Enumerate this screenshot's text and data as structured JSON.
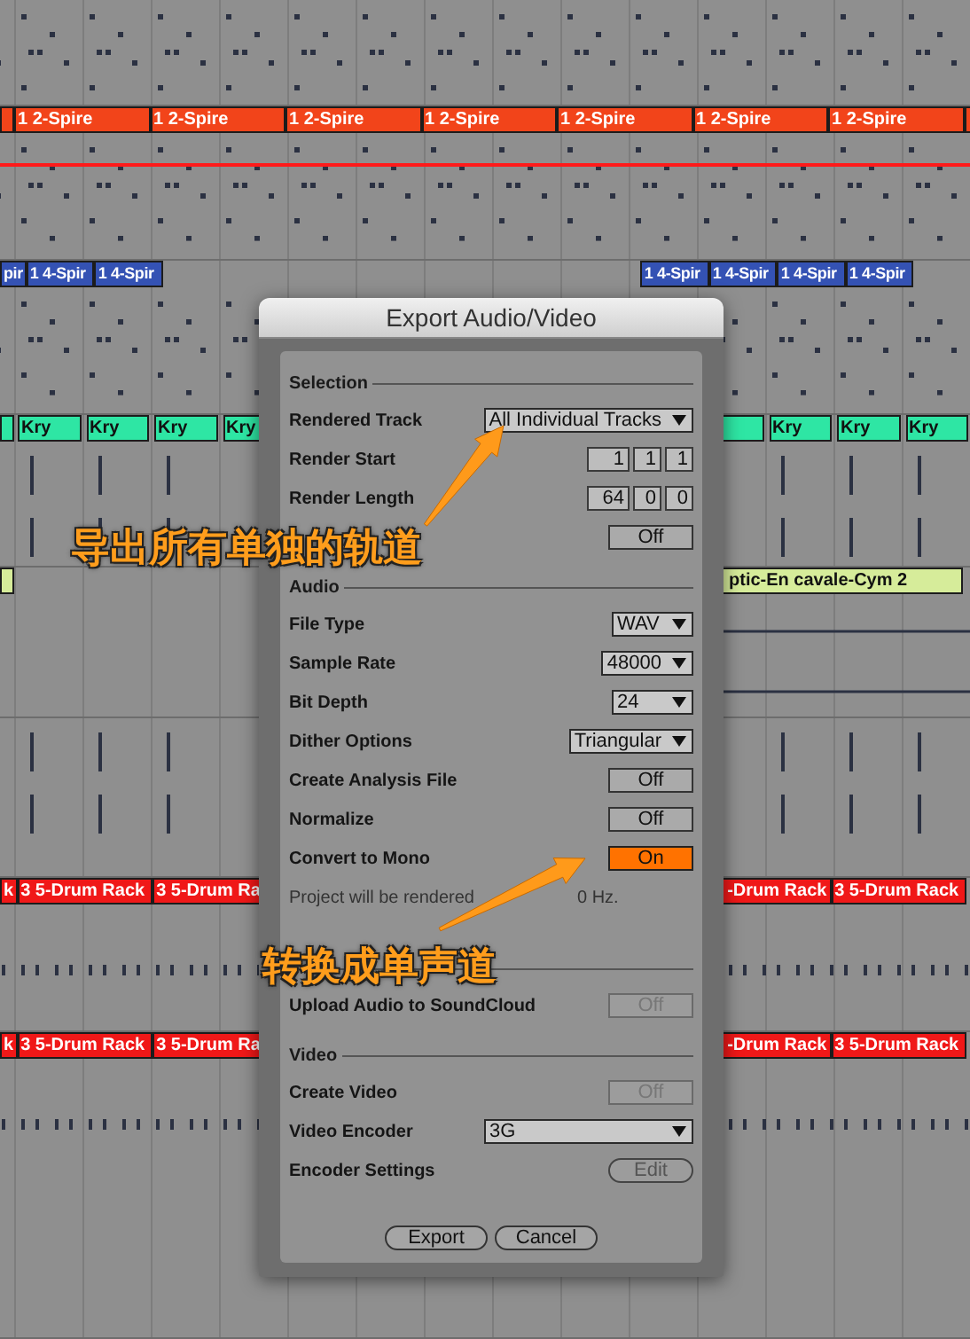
{
  "arrangement": {
    "tracks": [
      {
        "kind": "notes"
      },
      {
        "kind": "lead",
        "color": "#f2441a",
        "clips": [
          {
            "kind": "edge"
          },
          {
            "kind": "clip",
            "label": "1 2-Spire"
          },
          {
            "kind": "clip",
            "label": "1 2-Spire"
          },
          {
            "kind": "clip",
            "label": "1 2-Spire"
          },
          {
            "kind": "clip",
            "label": "1 2-Spire"
          },
          {
            "kind": "clip",
            "label": "1 2-Spire"
          },
          {
            "kind": "clip",
            "label": "1 2-Spire"
          },
          {
            "kind": "clip",
            "label": "1 2-Spire"
          },
          {
            "kind": "edge"
          }
        ]
      },
      {
        "kind": "pad",
        "color": "#3452b4",
        "clips": [
          {
            "kind": "edge",
            "label": "pir"
          },
          {
            "kind": "clip",
            "label": "1 4-Spir"
          },
          {
            "kind": "clip",
            "label": "1 4-Spir"
          },
          {
            "kind": "gap"
          },
          {
            "kind": "gap"
          },
          {
            "kind": "gap"
          },
          {
            "kind": "gap"
          },
          {
            "kind": "gap"
          },
          {
            "kind": "gap"
          },
          {
            "kind": "gap"
          },
          {
            "kind": "clip",
            "label": "1 4-Spir"
          },
          {
            "kind": "clip",
            "label": "1 4-Spir"
          },
          {
            "kind": "clip",
            "label": "1 4-Spir"
          },
          {
            "kind": "clip",
            "label": "1 4-Spir"
          }
        ]
      },
      {
        "kind": "shots",
        "color": "#2ee6a4",
        "clips": [
          {
            "kind": "edge"
          },
          {
            "kind": "clip",
            "label": "Kry"
          },
          {
            "kind": "clip",
            "label": "Kry"
          },
          {
            "kind": "clip",
            "label": "Kry"
          },
          {
            "kind": "clip",
            "label": "Kry"
          },
          {
            "kind": "gap"
          },
          {
            "kind": "gap"
          },
          {
            "kind": "gap"
          },
          {
            "kind": "gap"
          },
          {
            "kind": "gap"
          },
          {
            "kind": "gap"
          },
          {
            "kind": "clip"
          },
          {
            "kind": "clip",
            "label": "Kry"
          },
          {
            "kind": "clip",
            "label": "Kry"
          },
          {
            "kind": "clip",
            "label": "Kry"
          }
        ]
      },
      {
        "kind": "fx",
        "color": "#d6ec9a",
        "clips": [
          {
            "kind": "edge"
          },
          {
            "kind": "gap"
          },
          {
            "kind": "gap"
          },
          {
            "kind": "gap"
          },
          {
            "kind": "gap"
          },
          {
            "kind": "gap"
          },
          {
            "kind": "gap"
          },
          {
            "kind": "gap"
          },
          {
            "kind": "gap"
          },
          {
            "kind": "gap"
          },
          {
            "kind": "gap"
          },
          {
            "kind": "covered",
            "label": "ptic-En cavale-Cym 2"
          }
        ]
      },
      {
        "kind": "hits"
      },
      {
        "kind": "drum",
        "color": "#f01818",
        "clips": [
          {
            "kind": "edge",
            "label": "k"
          },
          {
            "kind": "clip",
            "label": "3 5-Drum Rack"
          },
          {
            "kind": "clip",
            "label": "3 5-Drum Ra"
          },
          {
            "kind": "gap"
          },
          {
            "kind": "gap"
          },
          {
            "kind": "gap"
          },
          {
            "kind": "covered",
            "label": "-Drum Rack"
          },
          {
            "kind": "clip",
            "label": "3 5-Drum Rack"
          }
        ]
      },
      {
        "kind": "drum",
        "color": "#f01818",
        "clips": [
          {
            "kind": "edge",
            "label": "k"
          },
          {
            "kind": "clip",
            "label": "3 5-Drum Rack"
          },
          {
            "kind": "clip",
            "label": "3 5-Drum Ra"
          },
          {
            "kind": "gap"
          },
          {
            "kind": "gap"
          },
          {
            "kind": "gap"
          },
          {
            "kind": "covered",
            "label": "-Drum Rack"
          },
          {
            "kind": "clip",
            "label": "3 5-Drum Rack"
          }
        ]
      }
    ]
  },
  "dialog": {
    "title": "Export Audio/Video",
    "sections": [
      {
        "title": "Selection",
        "rows": [
          {
            "kind": "dropdown",
            "label": "Rendered Track",
            "value": "All Individual Tracks"
          },
          {
            "kind": "numbers",
            "label": "Render Start",
            "values": [
              "1",
              "1",
              "1"
            ]
          },
          {
            "kind": "numbers",
            "label": "Render Length",
            "values": [
              "64",
              "0",
              "0"
            ]
          },
          {
            "kind": "toggle",
            "value": "Off",
            "on": false,
            "disabled": false
          }
        ]
      },
      {
        "title": "Audio",
        "rows": [
          {
            "kind": "dropdown",
            "label": "File Type",
            "value": "WAV"
          },
          {
            "kind": "dropdown",
            "label": "Sample Rate",
            "value": "48000"
          },
          {
            "kind": "dropdown",
            "label": "Bit Depth",
            "value": "24"
          },
          {
            "kind": "dropdown",
            "label": "Dither Options",
            "value": "Triangular"
          },
          {
            "kind": "toggle",
            "label": "Create Analysis File",
            "value": "Off",
            "on": false,
            "disabled": false
          },
          {
            "kind": "toggle",
            "label": "Normalize",
            "value": "Off",
            "on": false,
            "disabled": false
          },
          {
            "kind": "toggle",
            "label": "Convert to Mono",
            "value": "On",
            "on": true,
            "disabled": false
          },
          {
            "kind": "note",
            "parts": [
              "Project will be rendered",
              "0 Hz."
            ]
          }
        ]
      },
      {
        "rows": [
          {
            "kind": "toggle",
            "label": "Upload Audio to SoundCloud",
            "value": "Off",
            "on": false,
            "disabled": true
          }
        ]
      },
      {
        "title": "Video",
        "rows": [
          {
            "kind": "toggle",
            "label": "Create Video",
            "value": "Off",
            "on": false,
            "disabled": true
          },
          {
            "kind": "wide-dropdown",
            "label": "Video Encoder",
            "value": "3G"
          },
          {
            "kind": "button",
            "label": "Encoder Settings",
            "value": "Edit"
          }
        ]
      }
    ],
    "buttons": [
      "Export",
      "Cancel"
    ]
  },
  "annotations": [
    "导出所有单独的轨道",
    "转换成单声道"
  ]
}
